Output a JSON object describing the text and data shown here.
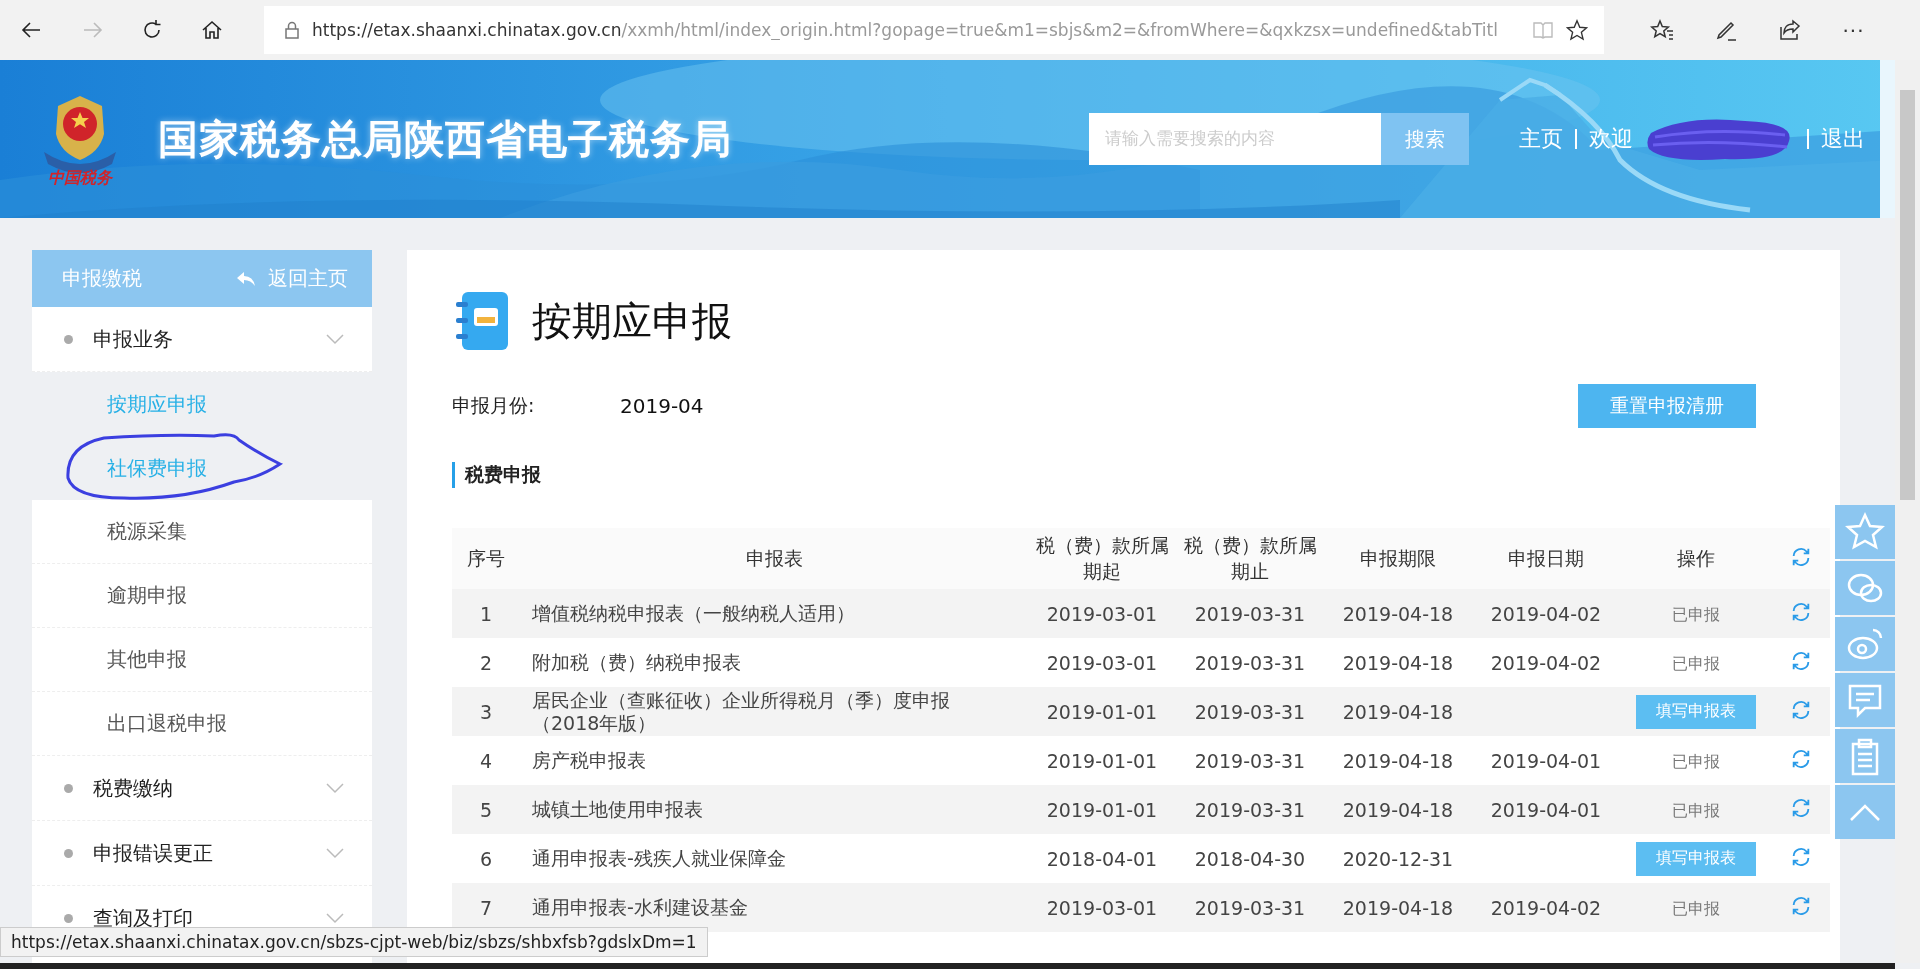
{
  "browser": {
    "nav": [
      {
        "kind": "back",
        "disabled": false
      },
      {
        "kind": "forward",
        "disabled": true
      },
      {
        "kind": "refresh",
        "disabled": false
      },
      {
        "kind": "home",
        "disabled": false
      }
    ],
    "address": {
      "host": "https://etax.shaanxi.chinatax.gov.cn",
      "path": "/xxmh/html/index_origin.html?gopage=true&m1=sbjs&m2=&fromWhere=&qxkzsx=undefined&tabTitl"
    },
    "tools": [
      {
        "kind": "favorites"
      },
      {
        "kind": "pen"
      },
      {
        "kind": "share"
      },
      {
        "kind": "more",
        "text": "···"
      }
    ],
    "status_url": "https://etax.shaanxi.chinatax.gov.cn/sbzs-cjpt-web/biz/sbzs/shbxfsb?gdslxDm=1"
  },
  "header": {
    "logo_caption": "中国税务",
    "title": "国家税务总局陕西省电子税务局",
    "search": {
      "placeholder": "请输入需要搜索的内容",
      "button": "搜索"
    },
    "home_link": "主页",
    "welcome": "欢迎",
    "user_redacted": true,
    "logout_link": "退出"
  },
  "sidebar": {
    "title": "申报缴税",
    "back_link": "返回主页",
    "groups": [
      {
        "label": "申报业务",
        "children": [
          {
            "label": "按期应申报",
            "selected": true
          },
          {
            "label": "社保费申报",
            "selected": true
          },
          {
            "label": "税源采集",
            "selected": false
          },
          {
            "label": "逾期申报",
            "selected": false
          },
          {
            "label": "其他申报",
            "selected": false
          },
          {
            "label": "出口退税申报",
            "selected": false
          }
        ]
      },
      {
        "label": "税费缴纳"
      },
      {
        "label": "申报错误更正"
      },
      {
        "label": "查询及打印"
      }
    ]
  },
  "main": {
    "title": "按期应申报",
    "month_label": "申报月份:",
    "month_value": "2019-04",
    "reset_button": "重置申报清册",
    "section_title": "税费申报",
    "table": {
      "columns": [
        "序号",
        "申报表",
        "税（费）款所属期起",
        "税（费）款所属期止",
        "申报期限",
        "申报日期",
        "操作"
      ],
      "rows": [
        {
          "no": "1",
          "form": "增值税纳税申报表（一般纳税人适用）",
          "start": "2019-03-01",
          "end": "2019-03-31",
          "deadline": "2019-04-18",
          "date": "2019-04-02",
          "action": {
            "kind": "status",
            "text": "已申报"
          }
        },
        {
          "no": "2",
          "form": "附加税（费）纳税申报表",
          "start": "2019-03-01",
          "end": "2019-03-31",
          "deadline": "2019-04-18",
          "date": "2019-04-02",
          "action": {
            "kind": "status",
            "text": "已申报"
          }
        },
        {
          "no": "3",
          "form": "居民企业（查账征收）企业所得税月（季）度申报（2018年版）",
          "start": "2019-01-01",
          "end": "2019-03-31",
          "deadline": "2019-04-18",
          "action": {
            "kind": "button",
            "text": "填写申报表"
          }
        },
        {
          "no": "4",
          "form": "房产税申报表",
          "start": "2019-01-01",
          "end": "2019-03-31",
          "deadline": "2019-04-18",
          "date": "2019-04-01",
          "action": {
            "kind": "status",
            "text": "已申报"
          }
        },
        {
          "no": "5",
          "form": "城镇土地使用申报表",
          "start": "2019-01-01",
          "end": "2019-03-31",
          "deadline": "2019-04-18",
          "date": "2019-04-01",
          "action": {
            "kind": "status",
            "text": "已申报"
          }
        },
        {
          "no": "6",
          "form": "通用申报表-残疾人就业保障金",
          "start": "2018-04-01",
          "end": "2018-04-30",
          "deadline": "2020-12-31",
          "action": {
            "kind": "button",
            "text": "填写申报表"
          }
        },
        {
          "no": "7",
          "form": "通用申报表-水利建设基金",
          "start": "2019-03-01",
          "end": "2019-03-31",
          "deadline": "2019-04-18",
          "date": "2019-04-02",
          "action": {
            "kind": "status",
            "text": "已申报"
          }
        }
      ]
    }
  },
  "float_tools": [
    {
      "kind": "star"
    },
    {
      "kind": "chat"
    },
    {
      "kind": "weibo"
    },
    {
      "kind": "message"
    },
    {
      "kind": "clipboard"
    },
    {
      "kind": "top"
    }
  ]
}
